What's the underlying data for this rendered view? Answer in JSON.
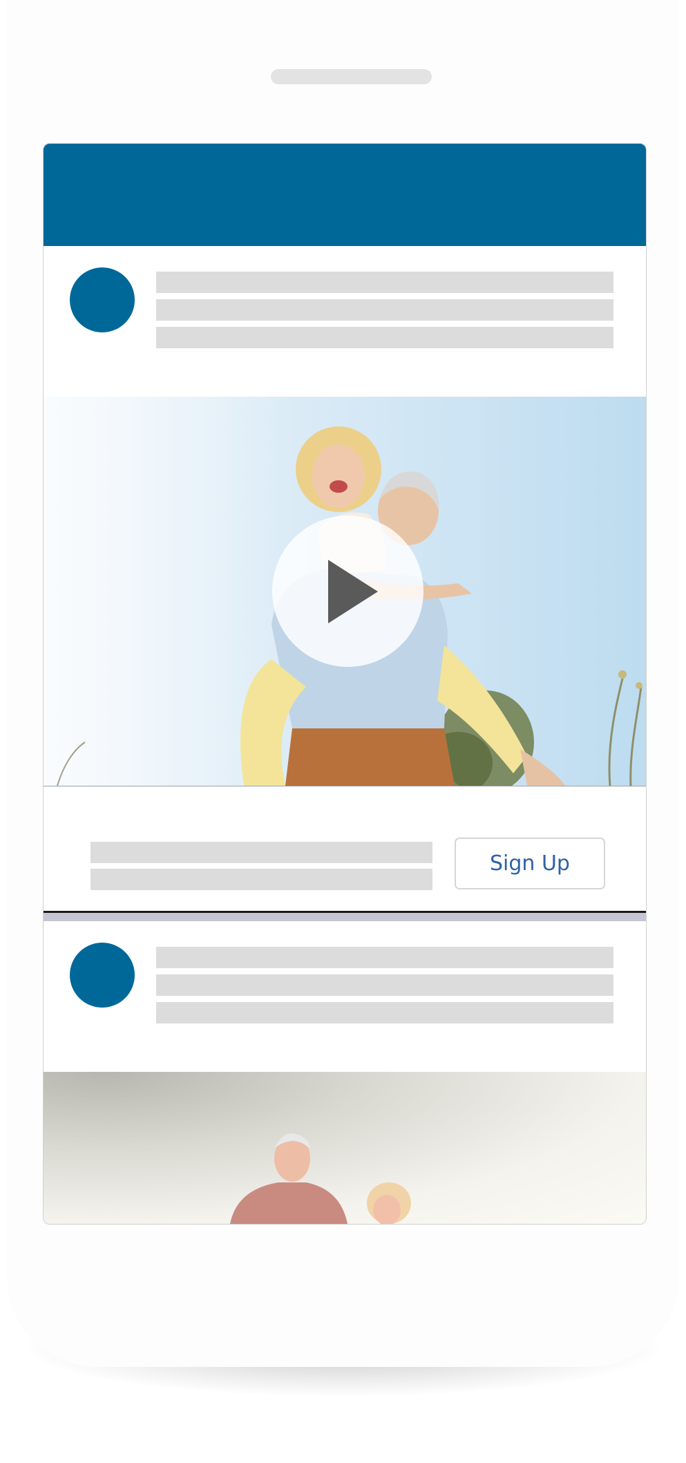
{
  "cta": {
    "signup_label": "Sign Up"
  },
  "colors": {
    "brand_blue": "#006898",
    "placeholder_gray": "#dcdcdc",
    "button_text": "#2e62a5",
    "divider": "#c5c6d4"
  },
  "icons": {
    "play": "play-icon"
  },
  "media": {
    "video_description": "video-thumbnail-couple-piggyback",
    "photo_description": "photo-couple-outdoors"
  }
}
